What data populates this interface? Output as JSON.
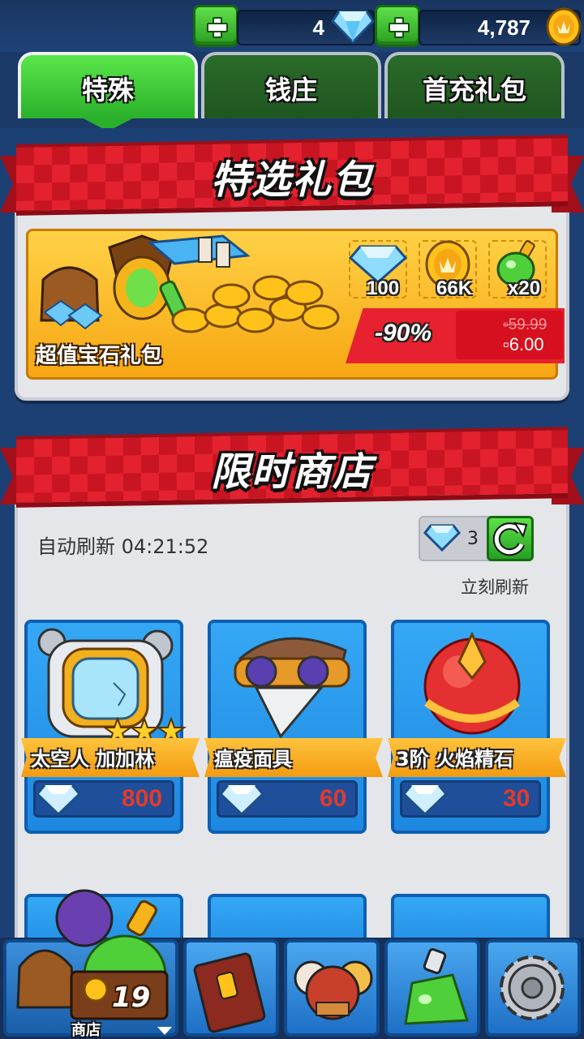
{
  "currency": {
    "gems": "4",
    "coins": "4,787"
  },
  "tabs": [
    {
      "label": "特殊",
      "active": true
    },
    {
      "label": "钱庄",
      "active": false
    },
    {
      "label": "首充礼包",
      "active": false
    }
  ],
  "featured": {
    "banner_title": "特选礼包",
    "pack_name": "超值宝石礼包",
    "rewards": [
      {
        "icon": "diamond-icon",
        "qty": "100"
      },
      {
        "icon": "coin-icon",
        "qty": "66K"
      },
      {
        "icon": "potion-icon",
        "qty": "x20"
      }
    ],
    "discount": "-90%",
    "old_price": "▫59.99",
    "new_price": "▫6.00"
  },
  "limited_shop": {
    "banner_title": "限时商店",
    "auto_refresh_label": "自动刷新 04:21:52",
    "refresh_cost": "3",
    "refresh_now_label": "立刻刷新",
    "items": [
      {
        "name": "太空人 加加林",
        "price": "800",
        "icon": "astronaut-helmet-icon",
        "stars": 3
      },
      {
        "name": "瘟疫面具",
        "price": "60",
        "icon": "plague-mask-icon",
        "stars": 0
      },
      {
        "name": "3阶 火焰精石",
        "price": "30",
        "icon": "fire-stone-icon",
        "stars": 0
      }
    ]
  },
  "bottom_nav": {
    "shop_label": "商店",
    "shop_badge": "19",
    "items": [
      "shop-icon",
      "book-icon",
      "heroes-icon",
      "potion-icon",
      "settings-gear-icon"
    ]
  },
  "colors": {
    "accent_green": "#2bb02a",
    "banner_red": "#e4212f",
    "price_red": "#e23a2b",
    "card_blue": "#1e88e0"
  }
}
